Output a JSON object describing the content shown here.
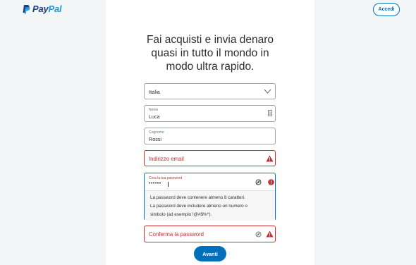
{
  "header": {
    "brand_pay": "Pay",
    "brand_pal": "Pal",
    "login_label": "Accedi"
  },
  "signup": {
    "headline_lines": [
      "Fai acquisti e invia denaro",
      "quasi in tutto il mondo in",
      "modo ultra rapido."
    ],
    "country": {
      "value": "Italia",
      "icon": "chevron-down-icon"
    },
    "first_name": {
      "label": "Nome",
      "value": "Luca",
      "icon": "contact-card-icon"
    },
    "last_name": {
      "label": "Cognome",
      "value": "Rossi"
    },
    "email": {
      "placeholder": "Indirizzo email",
      "status": "error",
      "icon": "warning-icon"
    },
    "password": {
      "label": "Crea la tua password",
      "value_masked": "••••••",
      "icons": [
        "show-password-icon",
        "info-icon"
      ],
      "help_lines": [
        "La password deve contenere almeno 8 caratteri.",
        "La password deve includere almeno un numero o",
        "simbolo (ad esempio !@#$%^)."
      ]
    },
    "confirm_password": {
      "placeholder": "Conferma la password",
      "status": "error",
      "icons": [
        "show-password-icon",
        "warning-icon"
      ]
    },
    "next_label": "Avanti"
  },
  "colors": {
    "brand_dark": "#253b80",
    "brand_light": "#179bd7",
    "primary": "#0070ba",
    "error": "#c72e2f"
  }
}
